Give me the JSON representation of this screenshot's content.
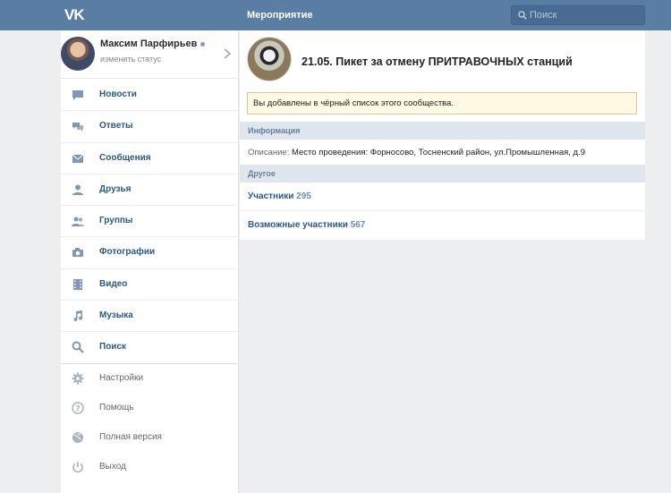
{
  "header": {
    "logo": "VK",
    "title": "Мероприятие",
    "search_placeholder": "Поиск"
  },
  "profile": {
    "name": "Максим Парфирьев",
    "status": "изменить статус"
  },
  "menu": [
    {
      "label": "Новости",
      "icon": "news-icon"
    },
    {
      "label": "Ответы",
      "icon": "replies-icon"
    },
    {
      "label": "Сообщения",
      "icon": "messages-icon"
    },
    {
      "label": "Друзья",
      "icon": "friends-icon"
    },
    {
      "label": "Группы",
      "icon": "groups-icon"
    },
    {
      "label": "Фотографии",
      "icon": "photos-icon"
    },
    {
      "label": "Видео",
      "icon": "video-icon"
    },
    {
      "label": "Музыка",
      "icon": "music-icon"
    },
    {
      "label": "Поиск",
      "icon": "search-icon"
    }
  ],
  "menu_secondary": [
    {
      "label": "Настройки",
      "icon": "gear-icon"
    },
    {
      "label": "Помощь",
      "icon": "help-icon"
    },
    {
      "label": "Полная версия",
      "icon": "globe-icon"
    },
    {
      "label": "Выход",
      "icon": "power-icon"
    }
  ],
  "event": {
    "title": "21.05. Пикет за отмену ПРИТРАВОЧНЫХ станций",
    "notice": "Вы добавлены в чёрный список этого сообщества.",
    "info_header": "Информация",
    "description_key": "Описание:",
    "description_value": "Место проведения: Форносово, Тосненский район, ул.Промышленная, д.9",
    "other_header": "Другое",
    "members_label": "Участники",
    "members_count": "295",
    "maybe_label": "Возможные участники",
    "maybe_count": "567"
  },
  "colors": {
    "header": "#597da3",
    "link": "#2a5885",
    "section_header_bg": "#dfe6ee",
    "notice_bg": "#fdf9e2",
    "menu_icon": "#7f98b5"
  }
}
